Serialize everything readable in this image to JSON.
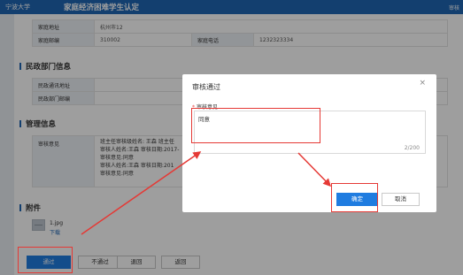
{
  "header": {
    "logo_text": "宁波大学",
    "title": "家庭经济困难学生认定",
    "right_text": "审核"
  },
  "family": {
    "address_label": "家庭地址",
    "address_value": "杭州市12",
    "postcode_label": "家庭邮编",
    "postcode_value": "310002",
    "phone_label": "家庭电话",
    "phone_value": "1232323334"
  },
  "civil": {
    "title": "民政部门信息",
    "address_label": "民政通讯地址",
    "postcode_label": "民政部门邮编",
    "partial_label": "民"
  },
  "management": {
    "title": "管理信息",
    "opinion_label": "审核意见",
    "opinion_lines": [
      "班主任审核级姓名: 王森   班主任",
      "审核人姓名:王森  审核日期:2017-",
      "审核意见:同意",
      "审核人姓名:王森  审核日期:201",
      "审核意见:同意"
    ]
  },
  "attachments": {
    "title": "附件",
    "file_name": "1.jpg",
    "download_label": "下载"
  },
  "actions": {
    "pass_label": "通过",
    "reject_label": "不通过",
    "return_label_1": "退回",
    "return_label_2": "返回"
  },
  "modal": {
    "title": "审核通过",
    "close_glyph": "×",
    "field_label": "审核意见",
    "required_mark": "*",
    "opinion_value": "同意",
    "counter": "2/200",
    "confirm_label": "确定",
    "cancel_label": "取消"
  },
  "colors": {
    "header_blue": "#1f66b3",
    "primary_button": "#1f7ce0",
    "highlight_red": "#e53935"
  },
  "icons": {
    "file": "file-thumbnail-icon",
    "close": "close-icon"
  }
}
